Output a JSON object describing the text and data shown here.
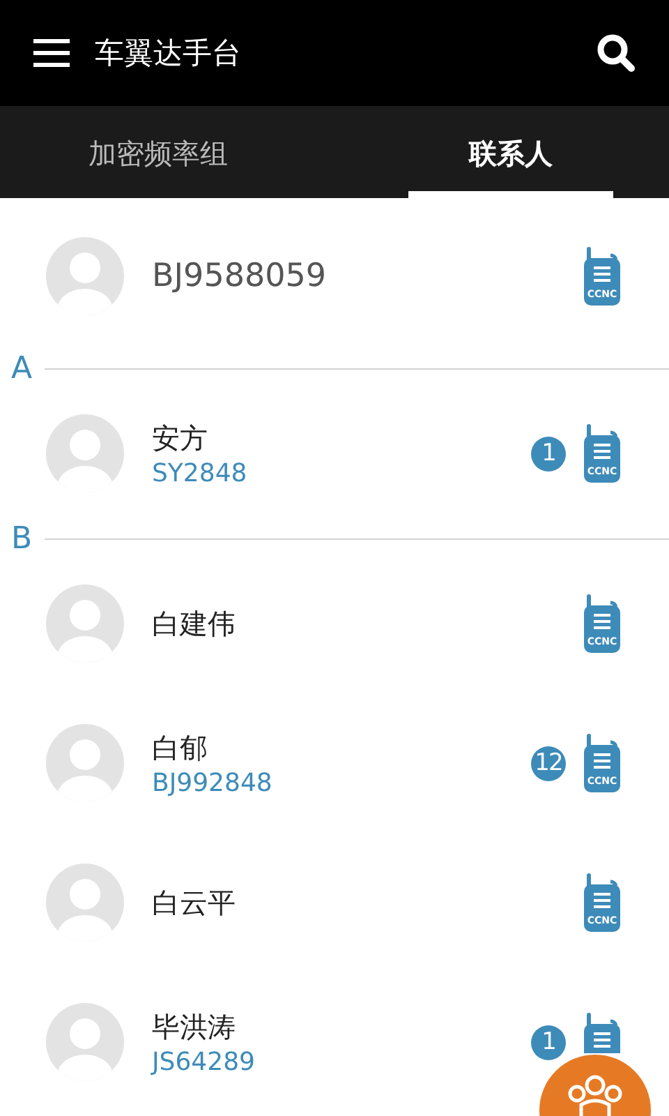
{
  "app_bar": {
    "title": "车翼达手台"
  },
  "tabs": [
    {
      "label": "加密频率组",
      "selected": false
    },
    {
      "label": "联系人",
      "selected": true
    }
  ],
  "contacts": [
    {
      "kind": "contact",
      "name": "BJ9588059",
      "device_label": "CCNC"
    },
    {
      "kind": "header",
      "letter": "A"
    },
    {
      "kind": "contact",
      "name": "安方",
      "subtitle": "SY2848",
      "badge": "1",
      "device_label": "CCNC"
    },
    {
      "kind": "header",
      "letter": "B"
    },
    {
      "kind": "contact",
      "name": "白建伟",
      "device_label": "CCNC"
    },
    {
      "kind": "contact",
      "name": "白郁",
      "subtitle": "BJ992848",
      "badge": "12",
      "device_label": "CCNC"
    },
    {
      "kind": "contact",
      "name": "白云平",
      "device_label": "CCNC"
    },
    {
      "kind": "contact",
      "name": "毕洪涛",
      "subtitle": "JS64289",
      "badge": "1"
    }
  ]
}
